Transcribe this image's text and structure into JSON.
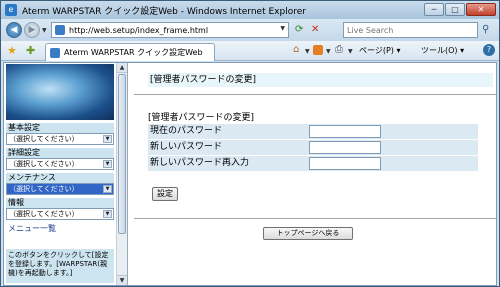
{
  "window": {
    "title": "Aterm WARPSTAR クイック設定Web - Windows Internet Explorer",
    "controls": {
      "minimize": "─",
      "maximize": "□",
      "close": "✕"
    }
  },
  "browser": {
    "address": "http://web.setup/index_frame.html",
    "search_placeholder": "Live Search",
    "tab_label": "Aterm WARPSTAR クイック設定Web",
    "page_menu": "ページ(P) ▾",
    "tools_menu": "ツール(O) ▾",
    "help": "?"
  },
  "left_frame": {
    "banner_text": "",
    "sections": [
      {
        "head": "基本設定",
        "selected": "（選択してください）",
        "active": false
      },
      {
        "head": "詳細設定",
        "selected": "（選択してください）",
        "active": false
      },
      {
        "head": "メンテナンス",
        "selected": "（選択してください）",
        "active": true
      },
      {
        "head": "情報",
        "selected": "（選択してください）",
        "active": false
      }
    ],
    "menu_list": "メニュー一覧",
    "help_text": "このボタンをクリックして[設定を登録します。[WARPSTAR(親機)を再起動します。]"
  },
  "main": {
    "heading": "[管理者パスワードの変更]",
    "section_title": "[管理者パスワードの変更]",
    "fields": [
      {
        "label": "現在のパスワード",
        "value": ""
      },
      {
        "label": "新しいパスワード",
        "value": ""
      },
      {
        "label": "新しいパスワード再入力",
        "value": ""
      }
    ],
    "set_button": "設定",
    "top_page_button": "トップページへ戻る"
  },
  "colors": {
    "heading_bg": "#e8f6fb",
    "form_row_bg": "#dbe9f3",
    "menu_head_bg": "#cce4ef",
    "active_select": "#3166c7"
  }
}
